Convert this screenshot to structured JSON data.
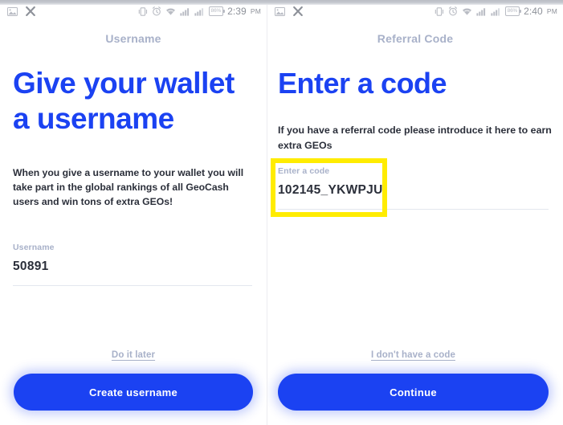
{
  "screens": [
    {
      "id": "username-screen",
      "statusbar": {
        "left_icons": [
          "image-icon",
          "close-x-icon"
        ],
        "right_icons": [
          "vibrate-icon",
          "alarm-icon",
          "wifi-icon",
          "signal-icon",
          "signal-icon-2"
        ],
        "battery": "86%",
        "time": "2:39",
        "ampm": "PM"
      },
      "page_title": "Username",
      "headline": "Give your wallet a username",
      "body_copy": "When you give a username to your wallet you will take part in the global rankings of all GeoCash users and win tons of extra GEOs!",
      "field": {
        "label": "Username",
        "value": "50891",
        "placeholder": "Username"
      },
      "secondary_link": "Do it later",
      "primary_button": "Create username"
    },
    {
      "id": "referral-screen",
      "statusbar": {
        "left_icons": [
          "image-icon",
          "close-x-icon"
        ],
        "right_icons": [
          "vibrate-icon",
          "alarm-icon",
          "wifi-icon",
          "signal-icon",
          "signal-icon-2"
        ],
        "battery": "86%",
        "time": "2:40",
        "ampm": "PM"
      },
      "page_title": "Referral Code",
      "headline": "Enter a code",
      "body_copy": "If you have a referral code please introduce it here to earn extra GEOs",
      "field": {
        "label": "Enter a code",
        "value": "102145_YKWPJU",
        "placeholder": "Enter a code"
      },
      "secondary_link": "I don't have a code",
      "primary_button": "Continue"
    }
  ],
  "annotation": {
    "highlight_color": "#ffec00",
    "target": "referral-code-input"
  },
  "colors": {
    "brand_blue": "#1b42f2",
    "muted_blue_gray": "#a8b1c9",
    "text_dark": "#2b2f3a",
    "highlight_yellow": "#ffec00",
    "divider": "#e3e7ee"
  }
}
